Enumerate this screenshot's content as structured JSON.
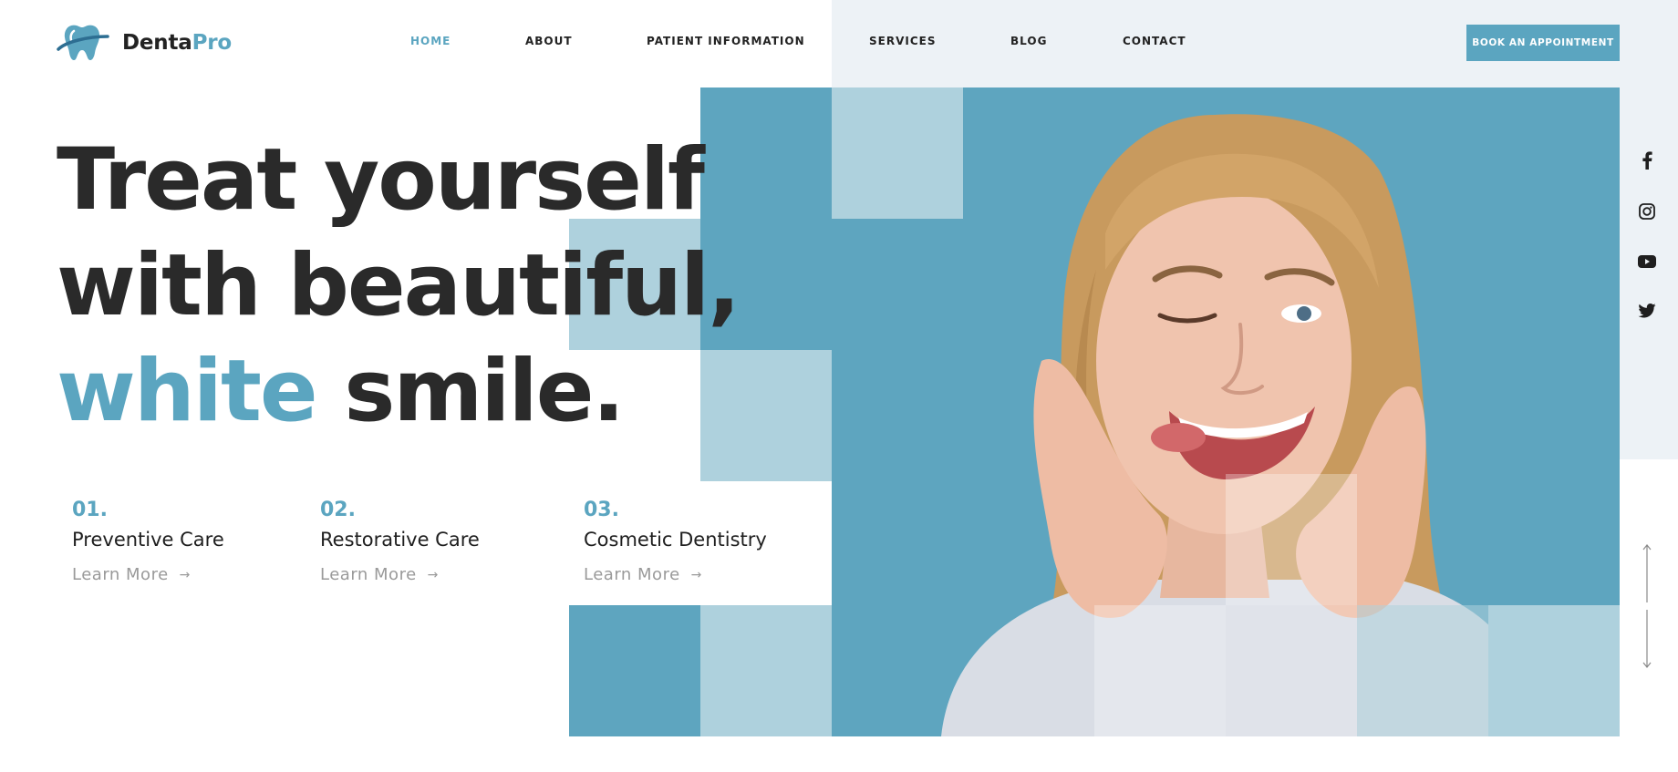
{
  "brand": {
    "name_part1": "Denta",
    "name_part2": "Pro",
    "accent_color": "#5ba5c0"
  },
  "nav": {
    "items": [
      {
        "label": "HOME",
        "active": true
      },
      {
        "label": "ABOUT"
      },
      {
        "label": "PATIENT INFORMATION"
      },
      {
        "label": "SERVICES"
      },
      {
        "label": "BLOG"
      },
      {
        "label": "CONTACT"
      }
    ],
    "cta_label": "BOOK AN APPOINTMENT"
  },
  "hero": {
    "line1": "Treat yourself",
    "line2": "with beautiful,",
    "line3_accent": "white",
    "line3_rest": "smile."
  },
  "services": [
    {
      "number": "01.",
      "title": "Preventive Care",
      "link": "Learn More",
      "arrow": "→"
    },
    {
      "number": "02.",
      "title": "Restorative Care",
      "link": "Learn More",
      "arrow": "→"
    },
    {
      "number": "03.",
      "title": "Cosmetic Dentistry",
      "link": "Learn More",
      "arrow": "→"
    }
  ],
  "social_icons": [
    "facebook-icon",
    "instagram-icon",
    "youtube-icon",
    "twitter-icon"
  ],
  "colors": {
    "primary_blue": "#5ea5bf",
    "light_blue": "#aed1dd",
    "text_dark": "#2a2a2a",
    "tint": "#edf2f6"
  }
}
